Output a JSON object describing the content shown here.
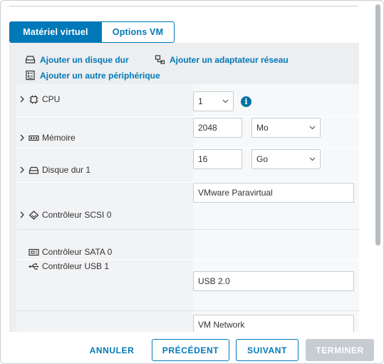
{
  "tabs": {
    "virtual_hardware": "Matériel virtuel",
    "vm_options": "Options VM"
  },
  "actions": {
    "add_hard_disk": "Ajouter un disque dur",
    "add_network_adapter": "Ajouter un adaptateur réseau",
    "add_other_device": "Ajouter un autre périphérique"
  },
  "hardware": {
    "cpu": {
      "label": "CPU",
      "value": "1"
    },
    "memory": {
      "label": "Mémoire",
      "value": "2048",
      "unit": "Mo"
    },
    "hard_disk": {
      "label": "Disque dur 1",
      "value": "16",
      "unit": "Go"
    },
    "scsi": {
      "label": "Contrôleur SCSI 0",
      "value": "VMware Paravirtual"
    },
    "sata": {
      "label": "Contrôleur SATA 0"
    },
    "usb": {
      "label": "Contrôleur USB 1",
      "value": "USB 2.0"
    },
    "network": {
      "value": "VM Network"
    }
  },
  "footer": {
    "cancel": "ANNULER",
    "previous": "PRÉCÉDENT",
    "next": "SUIVANT",
    "finish": "TERMINER"
  },
  "icons": {
    "info": "i"
  },
  "colors": {
    "accent": "#0079b8",
    "panel_bg": "#eceef0",
    "disabled": "#c6ccd2",
    "info": "#0072a3"
  }
}
